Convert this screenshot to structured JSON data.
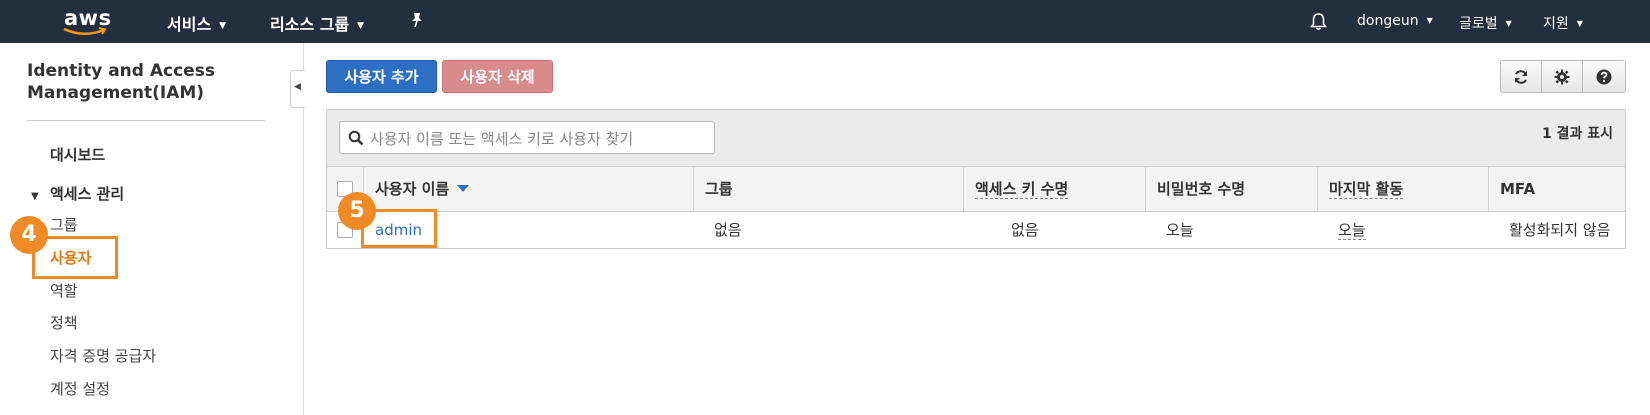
{
  "topnav": {
    "logo_text": "aws",
    "services": "서비스",
    "resource_groups": "리소스 그룹",
    "user": "dongeun",
    "region": "글로벌",
    "support": "지원"
  },
  "sidebar": {
    "title": "Identity and Access Management(IAM)",
    "dashboard": "대시보드",
    "access_mgmt": "액세스 관리",
    "items": [
      "그룹",
      "사용자",
      "역할",
      "정책",
      "자격 증명 공급자",
      "계정 설정"
    ]
  },
  "annotations": {
    "badge_sidebar": "4",
    "badge_row": "5",
    "accent": "#f08a24"
  },
  "toolbar": {
    "add_user": "사용자 추가",
    "delete_user": "사용자 삭제"
  },
  "search": {
    "placeholder": "사용자 이름 또는 액세스 키로 사용자 찾기",
    "value": ""
  },
  "results": "1 결과 표시",
  "table": {
    "headers": [
      "사용자 이름",
      "그룹",
      "액세스 키 수명",
      "비밀번호 수명",
      "마지막 활동",
      "MFA"
    ],
    "rows": [
      [
        "admin",
        "없음",
        "없음",
        "오늘",
        "오늘",
        "활성화되지 않음"
      ]
    ]
  },
  "colors": {
    "nav_bg": "#232f3e",
    "primary": "#2d6fc4",
    "danger_disabled": "#d98a8a",
    "active": "#e47911"
  },
  "icons": [
    "caret-down-icon",
    "pin-icon",
    "bell-icon",
    "refresh-icon",
    "gear-icon",
    "help-icon",
    "search-icon",
    "collapse-icon"
  ]
}
